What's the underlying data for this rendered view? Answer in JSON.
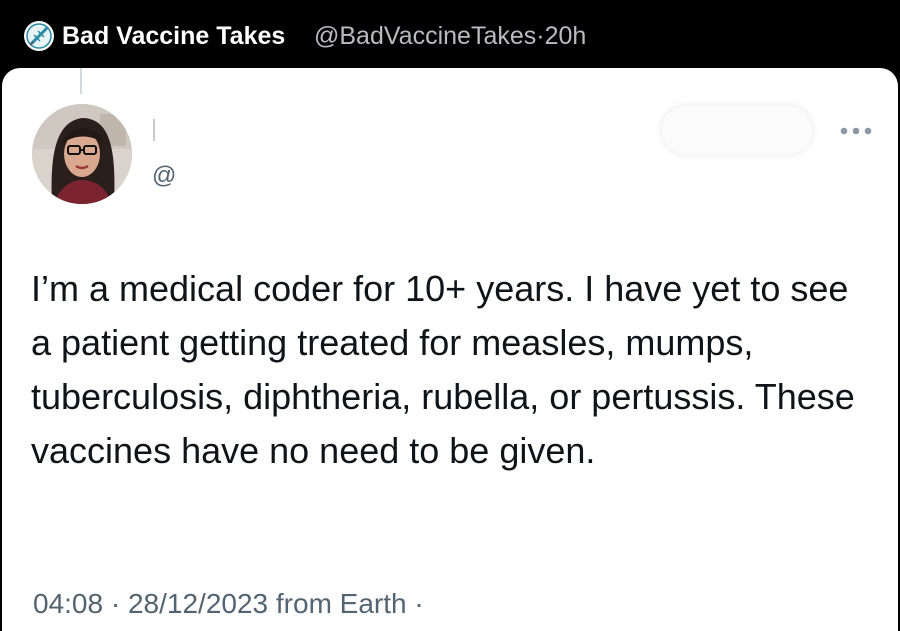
{
  "header": {
    "account_name": "Bad Vaccine Takes",
    "account_handle": "@BadVaccineTakes",
    "separator": "·",
    "time_ago": "20h",
    "avatar_icon": "vaccine-logo-icon"
  },
  "tweet": {
    "handle_prefix": "@",
    "more_icon": "more-options-icon",
    "text": "I’m a medical coder for 10+ years. I have yet to see a patient getting treated for measles, mumps, tuberculosis, diphtheria, rubella, or pertussis. These vaccines have no need to be given.",
    "time": "04:08",
    "date": "28/12/2023",
    "source": "from Earth",
    "separator": "·"
  },
  "colors": {
    "header_bg": "#000000",
    "card_bg": "#ffffff",
    "text_primary": "#0f1419",
    "text_secondary": "#536471"
  }
}
